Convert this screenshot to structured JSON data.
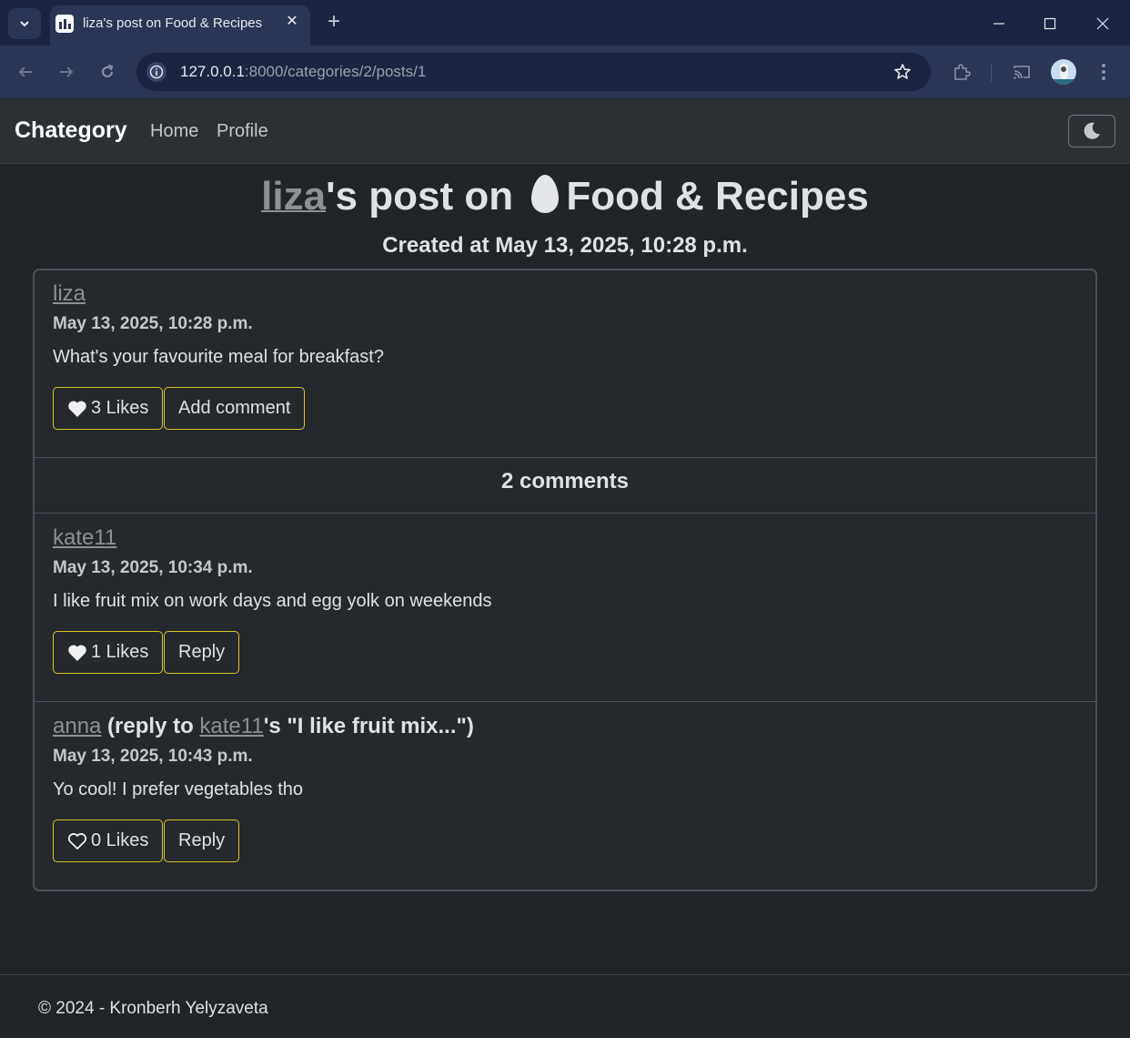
{
  "browser": {
    "tab_title": "liza's post on Food & Recipes",
    "url_host": "127.0.0.1",
    "url_rest": ":8000/categories/2/posts/1",
    "new_tab_label": "+"
  },
  "navbar": {
    "brand": "Chategory",
    "links": [
      "Home",
      "Profile"
    ]
  },
  "page": {
    "title_author": "liza",
    "title_mid": "'s post on ",
    "title_category": "Food & Recipes",
    "category_icon": "egg-icon",
    "created": "Created at May 13, 2025, 10:28 p.m."
  },
  "post": {
    "author": "liza",
    "date": "May 13, 2025, 10:28 p.m.",
    "text": "What's your favourite meal for breakfast?",
    "likes_label": "3 Likes",
    "liked": true,
    "comment_button": "Add comment"
  },
  "comments_count": "2 comments",
  "comments": [
    {
      "author": "kate11",
      "date": "May 13, 2025, 10:34 p.m.",
      "text": "I like fruit mix on work days and egg yolk on weekends",
      "likes_label": "1 Likes",
      "liked": true,
      "reply_label": "Reply"
    },
    {
      "author": "anna",
      "reply_prefix": " (reply to ",
      "reply_to": "kate11",
      "reply_suffix": "'s \"I like fruit mix...\")",
      "date": "May 13, 2025, 10:43 p.m.",
      "text": "Yo cool! I prefer vegetables tho",
      "likes_label": "0 Likes",
      "liked": false,
      "reply_label": "Reply"
    }
  ],
  "footer": {
    "text": "© 2024 - Kronberh Yelyzaveta"
  },
  "colors": {
    "accent_border": "#d8c52a",
    "background": "#212529",
    "link": "#8c9196"
  }
}
